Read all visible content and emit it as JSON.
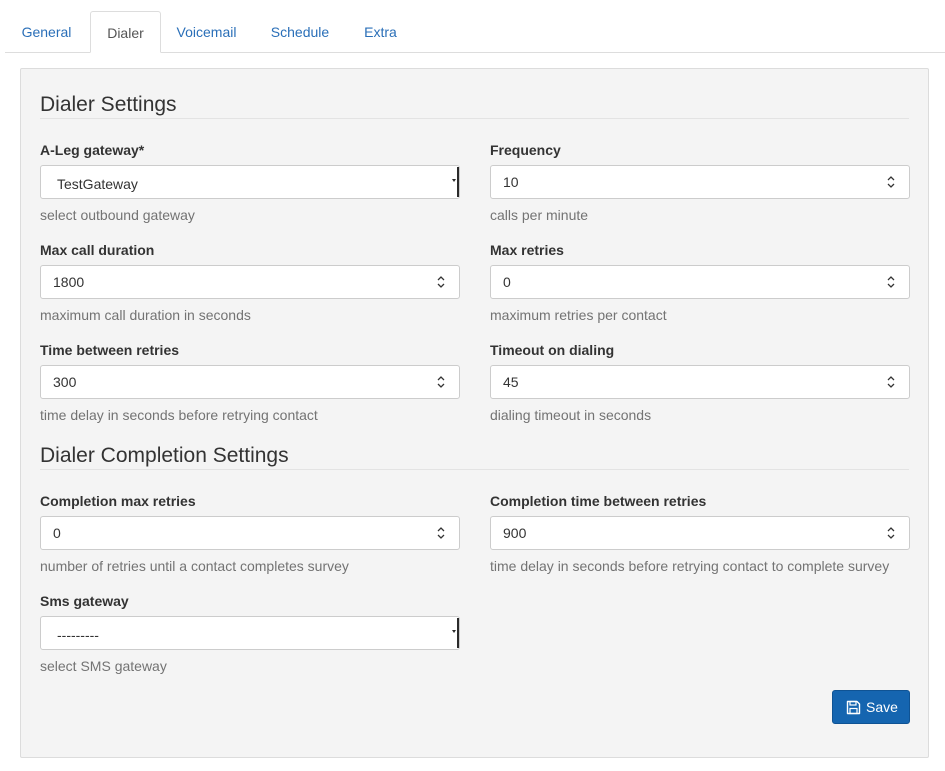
{
  "tabs": [
    {
      "label": "General",
      "active": false
    },
    {
      "label": "Dialer",
      "active": true
    },
    {
      "label": "Voicemail",
      "active": false
    },
    {
      "label": "Schedule",
      "active": false
    },
    {
      "label": "Extra",
      "active": false
    }
  ],
  "dialer_settings": {
    "title": "Dialer Settings",
    "aleg_gateway": {
      "label": "A-Leg gateway*",
      "value": "TestGateway",
      "help": "select outbound gateway"
    },
    "frequency": {
      "label": "Frequency",
      "value": "10",
      "help": "calls per minute"
    },
    "max_call_duration": {
      "label": "Max call duration",
      "value": "1800",
      "help": "maximum call duration in seconds"
    },
    "max_retries": {
      "label": "Max retries",
      "value": "0",
      "help": "maximum retries per contact"
    },
    "time_between_retries": {
      "label": "Time between retries",
      "value": "300",
      "help": "time delay in seconds before retrying contact"
    },
    "timeout_on_dialing": {
      "label": "Timeout on dialing",
      "value": "45",
      "help": "dialing timeout in seconds"
    }
  },
  "completion_settings": {
    "title": "Dialer Completion Settings",
    "completion_max_retries": {
      "label": "Completion max retries",
      "value": "0",
      "help": "number of retries until a contact completes survey"
    },
    "completion_time_between_retries": {
      "label": "Completion time between retries",
      "value": "900",
      "help": "time delay in seconds before retrying contact to complete survey"
    },
    "sms_gateway": {
      "label": "Sms gateway",
      "value": "---------",
      "help": "select SMS gateway"
    }
  },
  "save_button": {
    "label": "Save",
    "icon": "floppy-disk-icon"
  },
  "colors": {
    "accent": "#1565b0",
    "link": "#2a6fb8",
    "panel_bg": "#f4f4f4"
  }
}
